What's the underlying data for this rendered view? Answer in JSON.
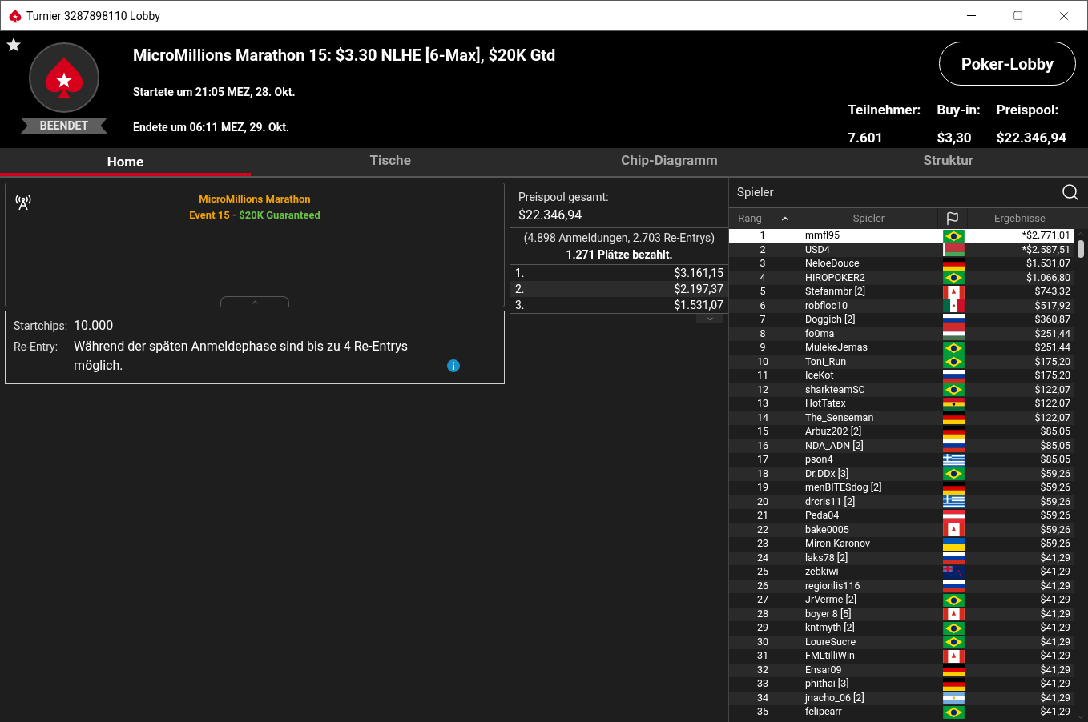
{
  "window": {
    "title": "Turnier 3287898110 Lobby"
  },
  "header": {
    "favorite": false,
    "status": "BEENDET",
    "title": "MicroMillions Marathon 15: $3.30 NLHE [6-Max], $20K Gtd",
    "started": "Startete um 21:05 MEZ, 28. Okt.",
    "ended": "Endete um 06:11 MEZ, 29. Okt.",
    "lobby_button": "Poker-Lobby",
    "stats": [
      {
        "label": "Teilnehmer:",
        "value": "7.601"
      },
      {
        "label": "Buy-in:",
        "value": "$3,30"
      },
      {
        "label": "Preispool:",
        "value": "$22.346,94"
      }
    ]
  },
  "tabs": [
    {
      "label": "Home",
      "selected": true
    },
    {
      "label": "Tische",
      "selected": false
    },
    {
      "label": "Chip-Diagramm",
      "selected": false
    },
    {
      "label": "Struktur",
      "selected": false
    }
  ],
  "banner": {
    "line1": "MicroMillions Marathon",
    "line2_a": "Event 15 - ",
    "line2_b": "$20K Guaranteed"
  },
  "info": {
    "startchips_label": "Startchips:",
    "startchips": "10.000",
    "reentry_label": "Re-Entry:",
    "reentry": "Während der späten Anmeldephase sind bis zu 4 Re-Entrys möglich."
  },
  "prizepool": {
    "label": "Preispool gesamt:",
    "value": "$22.346,94",
    "entries": "(4.898 Anmeldungen, 2.703 Re-Entrys)",
    "paid": "1.271 Plätze bezahlt.",
    "places": [
      {
        "place": "1.",
        "prize": "$3.161,15"
      },
      {
        "place": "2.",
        "prize": "$2.197,37"
      },
      {
        "place": "3.",
        "prize": "$1.531,07"
      }
    ]
  },
  "players": {
    "title": "Spieler",
    "columns": [
      "Rang",
      "Spieler",
      "Ergebnisse"
    ],
    "rows": [
      {
        "rank": "1",
        "name": "mmfl95",
        "kind": "br",
        "result": "*$2.771,01",
        "selected": true
      },
      {
        "rank": "2",
        "name": "USD4",
        "kind": "by",
        "result": "*$2.587,51",
        "selected": false
      },
      {
        "rank": "3",
        "name": "NeloeDouce",
        "kind": "de",
        "result": "$1.531,07",
        "selected": false
      },
      {
        "rank": "4",
        "name": "HIROPOKER2",
        "kind": "br",
        "result": "$1.066,80",
        "selected": false
      },
      {
        "rank": "5",
        "name": "Stefanmbr [2]",
        "kind": "ca",
        "result": "$743,32",
        "selected": false
      },
      {
        "rank": "6",
        "name": "robfloc10",
        "kind": "mx",
        "result": "$517,92",
        "selected": false
      },
      {
        "rank": "7",
        "name": "Doggich [2]",
        "kind": "ru",
        "result": "$360,87",
        "selected": false
      },
      {
        "rank": "8",
        "name": "fo0ma",
        "kind": "hu",
        "result": "$251,44",
        "selected": false
      },
      {
        "rank": "9",
        "name": "MulekeJemas",
        "kind": "br",
        "result": "$251,44",
        "selected": false
      },
      {
        "rank": "10",
        "name": "Toni_Run",
        "kind": "br",
        "result": "$175,20",
        "selected": false
      },
      {
        "rank": "11",
        "name": "IceKot",
        "kind": "ru",
        "result": "$175,20",
        "selected": false
      },
      {
        "rank": "12",
        "name": "sharkteamSC",
        "kind": "br",
        "result": "$122,07",
        "selected": false
      },
      {
        "rank": "13",
        "name": "HotTatex",
        "kind": "gh",
        "result": "$122,07",
        "selected": false
      },
      {
        "rank": "14",
        "name": "The_Senseman",
        "kind": "de",
        "result": "$122,07",
        "selected": false
      },
      {
        "rank": "15",
        "name": "Arbuz202 [2]",
        "kind": "de",
        "result": "$85,05",
        "selected": false
      },
      {
        "rank": "16",
        "name": "NDA_ADN [2]",
        "kind": "ru",
        "result": "$85,05",
        "selected": false
      },
      {
        "rank": "17",
        "name": "pson4",
        "kind": "gr",
        "result": "$85,05",
        "selected": false
      },
      {
        "rank": "18",
        "name": "Dr.DDx [3]",
        "kind": "br",
        "result": "$59,26",
        "selected": false
      },
      {
        "rank": "19",
        "name": "menBITESdog [2]",
        "kind": "de",
        "result": "$59,26",
        "selected": false
      },
      {
        "rank": "20",
        "name": "drcris11 [2]",
        "kind": "gr",
        "result": "$59,26",
        "selected": false
      },
      {
        "rank": "21",
        "name": "Peda04",
        "kind": "at",
        "result": "$59,26",
        "selected": false
      },
      {
        "rank": "22",
        "name": "bake0005",
        "kind": "ca",
        "result": "$59,26",
        "selected": false
      },
      {
        "rank": "23",
        "name": "Miron Karonov",
        "kind": "ua",
        "result": "$59,26",
        "selected": false
      },
      {
        "rank": "24",
        "name": "laks78 [2]",
        "kind": "ru",
        "result": "$41,29",
        "selected": false
      },
      {
        "rank": "25",
        "name": "zebkiwi",
        "kind": "nz",
        "result": "$41,29",
        "selected": false
      },
      {
        "rank": "26",
        "name": "regionlis116",
        "kind": "ru",
        "result": "$41,29",
        "selected": false
      },
      {
        "rank": "27",
        "name": "JrVerme [2]",
        "kind": "br",
        "result": "$41,29",
        "selected": false
      },
      {
        "rank": "28",
        "name": "boyer 8 [5]",
        "kind": "ca",
        "result": "$41,29",
        "selected": false
      },
      {
        "rank": "29",
        "name": "kntmyth [2]",
        "kind": "br",
        "result": "$41,29",
        "selected": false
      },
      {
        "rank": "30",
        "name": "LoureSucre",
        "kind": "br",
        "result": "$41,29",
        "selected": false
      },
      {
        "rank": "31",
        "name": "FMLtilliWin",
        "kind": "ca",
        "result": "$41,29",
        "selected": false
      },
      {
        "rank": "32",
        "name": "Ensar09",
        "kind": "de",
        "result": "$41,29",
        "selected": false
      },
      {
        "rank": "33",
        "name": "phithai [3]",
        "kind": "de",
        "result": "$41,29",
        "selected": false
      },
      {
        "rank": "34",
        "name": "jnacho_06 [2]",
        "kind": "ar",
        "result": "$41,29",
        "selected": false
      },
      {
        "rank": "35",
        "name": "felipearr",
        "kind": "br",
        "result": "$41,29",
        "selected": false
      }
    ]
  }
}
